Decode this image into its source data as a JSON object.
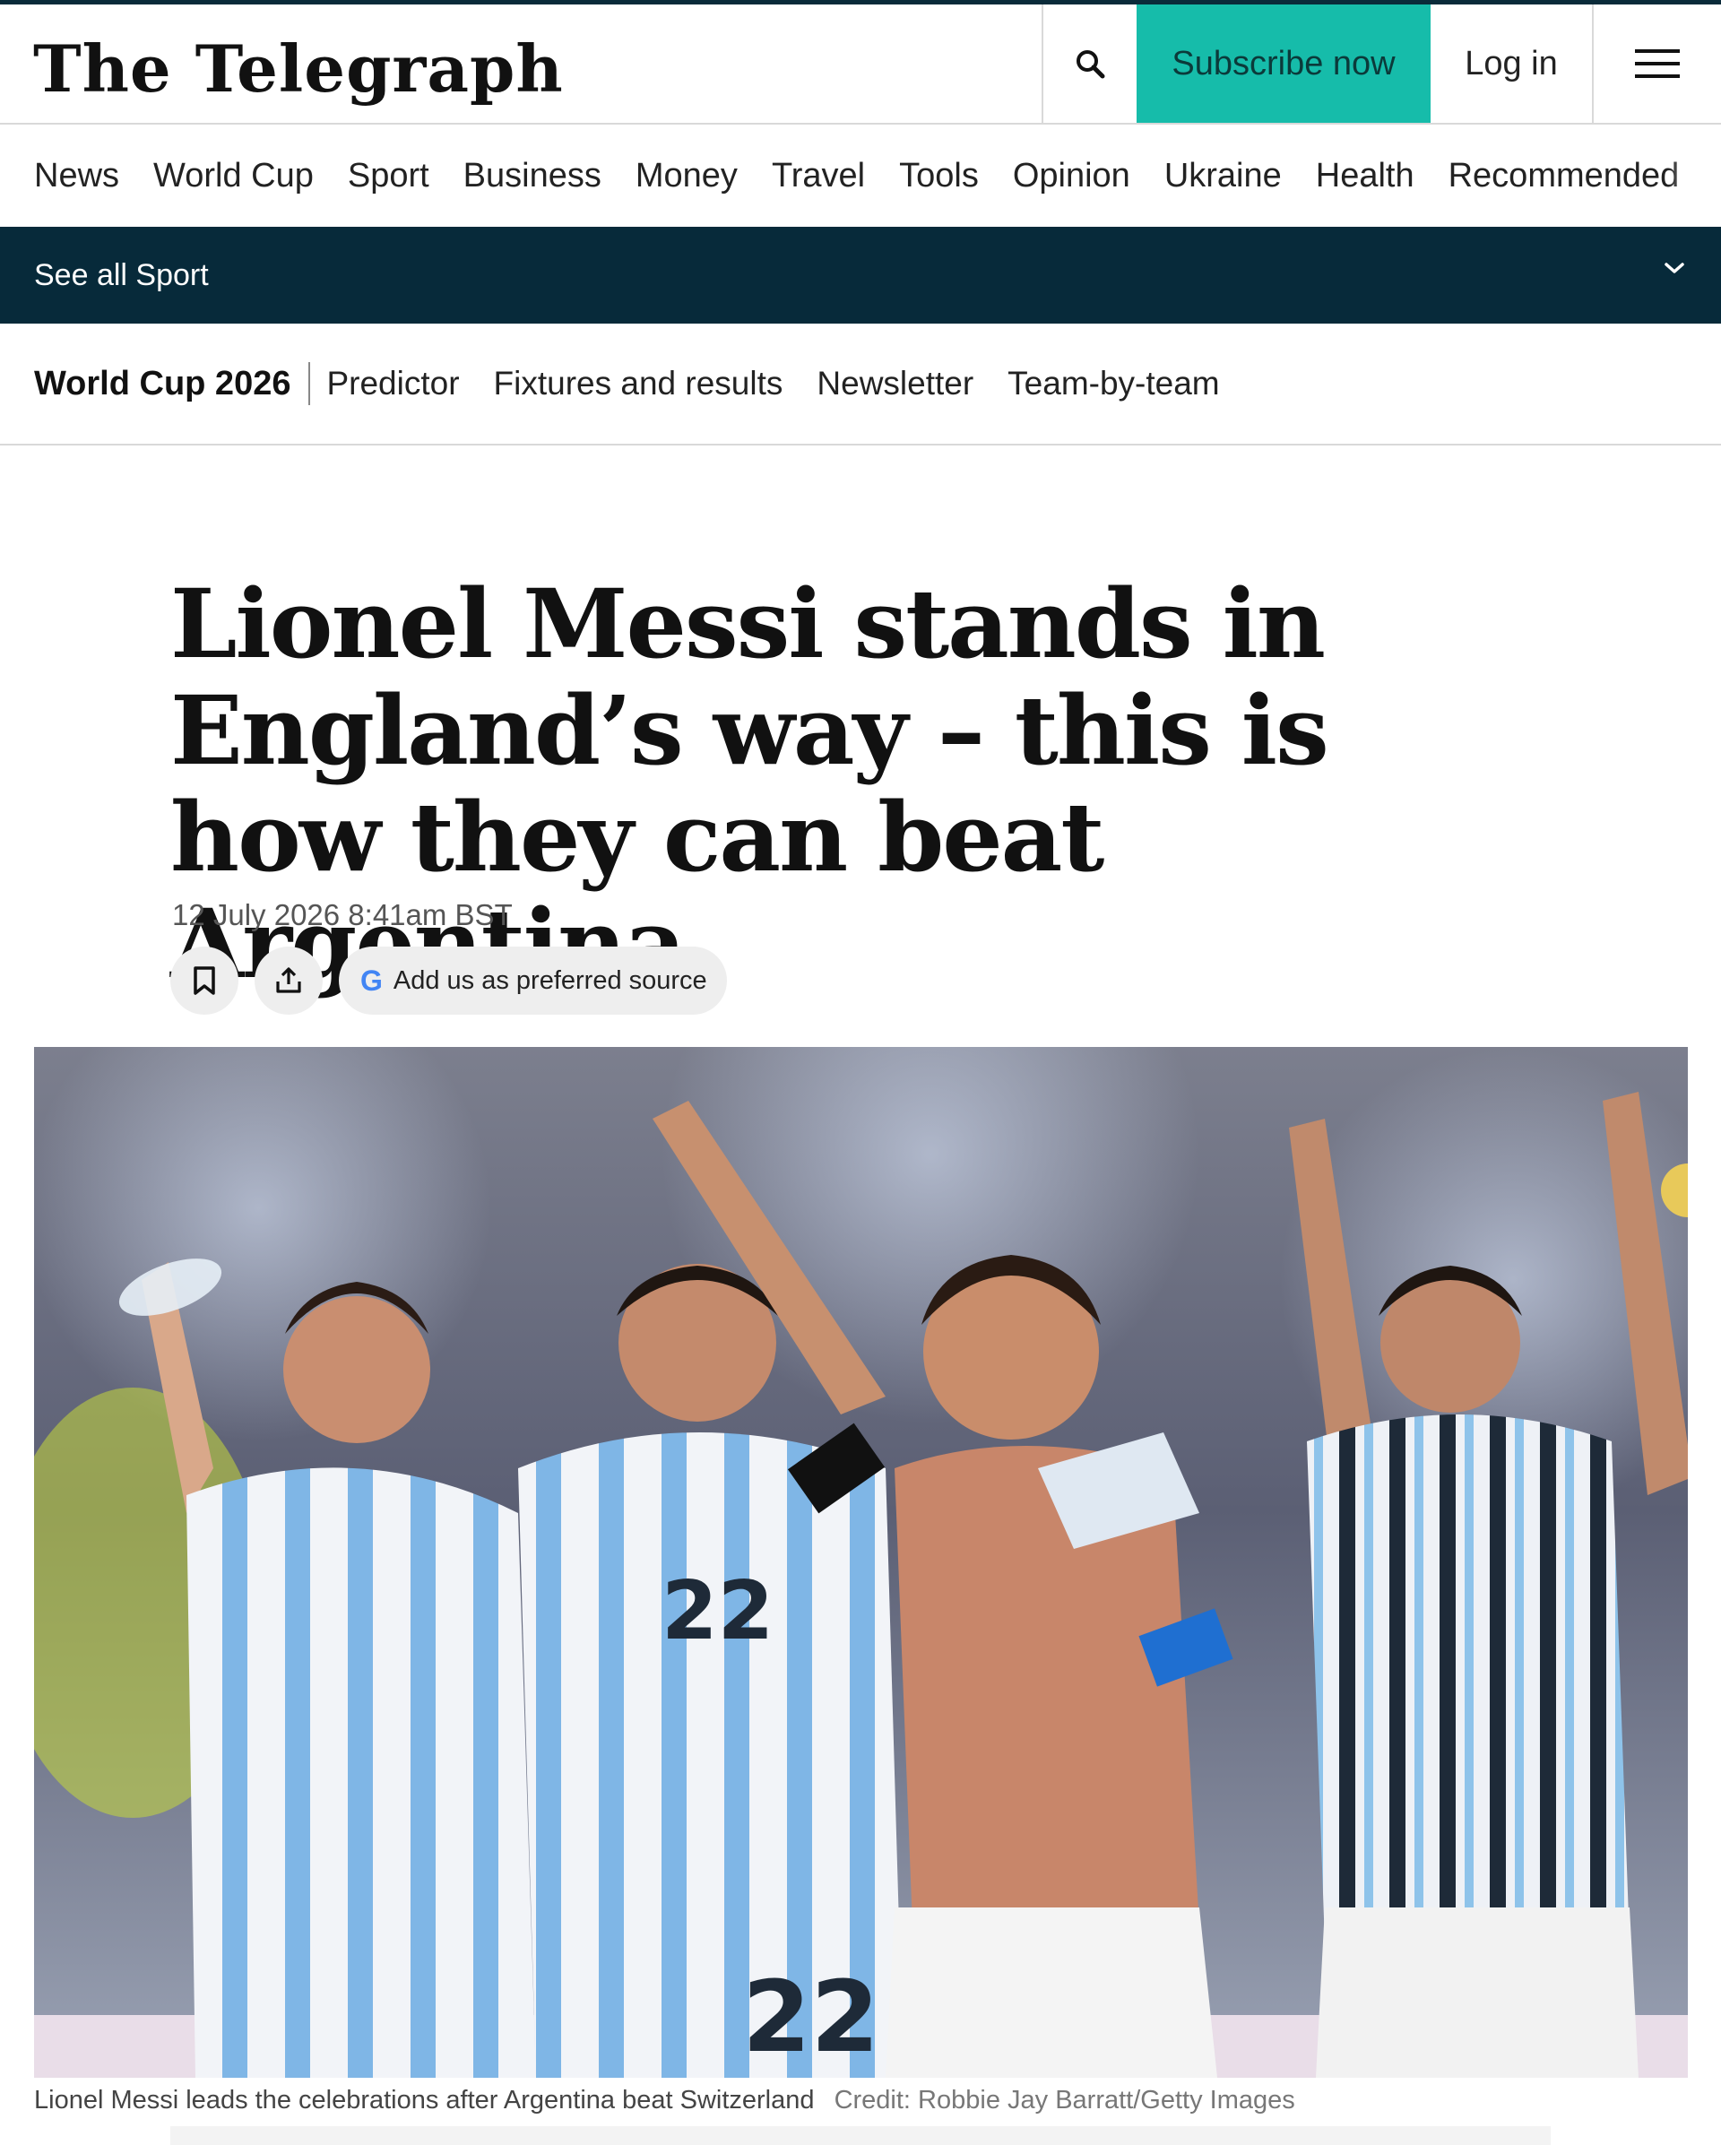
{
  "masthead": {
    "logo_text": "The Telegraph",
    "search_icon": "search-icon",
    "subscribe_label": "Subscribe now",
    "login_label": "Log in",
    "menu_icon": "hamburger-menu-icon",
    "accent_color": "#16bcaa"
  },
  "primary_nav": {
    "items": [
      "News",
      "World Cup",
      "Sport",
      "Business",
      "Money",
      "Travel",
      "Tools",
      "Opinion",
      "Ukraine",
      "Health",
      "Recommended"
    ]
  },
  "sport_bar": {
    "label": "See all Sport",
    "icon": "chevron-down-icon",
    "background_color": "#072a3a"
  },
  "sub_nav": {
    "section_title": "World Cup 2026",
    "items": [
      "Predictor",
      "Fixtures and results",
      "Newsletter",
      "Team-by-team"
    ]
  },
  "article": {
    "headline": "Lionel Messi stands in England’s way – this is how they can beat Argentina",
    "date": "12 July 2026 8:41am BST",
    "bookmark_icon": "bookmark-icon",
    "share_icon": "share-icon",
    "preferred_source_icon": "google-g-icon",
    "preferred_source_label": "Add us as preferred source",
    "image_caption": "Lionel Messi leads the celebrations after Argentina beat Switzerland",
    "image_credit": "Credit: Robbie Jay Barratt/Getty Images"
  }
}
